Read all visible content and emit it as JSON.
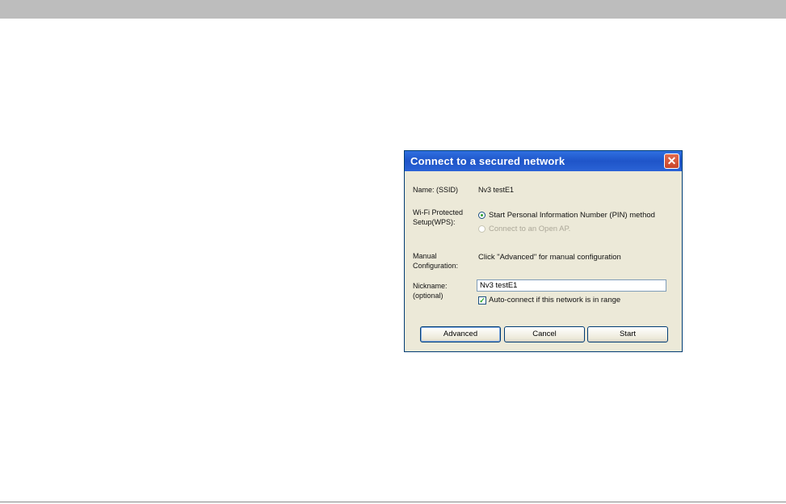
{
  "dialog": {
    "title": "Connect to a secured network",
    "close_label": "✕",
    "name_label": "Name: (SSID)",
    "ssid_value": "Nv3 testE1",
    "wps_label_line1": "Wi-Fi Protected",
    "wps_label_line2": "Setup(WPS):",
    "wps_option_pin": "Start Personal Information Number (PIN) method",
    "wps_option_open": "Connect to an Open AP.",
    "manual_label_line1": "Manual",
    "manual_label_line2": "Configuration:",
    "manual_hint": "Click \"Advanced\" for manual configuration",
    "nickname_label_line1": "Nickname:",
    "nickname_label_line2": "(optional)",
    "nickname_value": "Nv3 testE1",
    "auto_connect_label": "Auto-connect if this network is in range",
    "auto_connect_checked": true,
    "buttons": {
      "advanced": "Advanced",
      "cancel": "Cancel",
      "start": "Start"
    }
  },
  "colors": {
    "titlebar": "#2a63d6",
    "dialog_bg": "#ece9d8",
    "close_button": "#c8442a"
  }
}
